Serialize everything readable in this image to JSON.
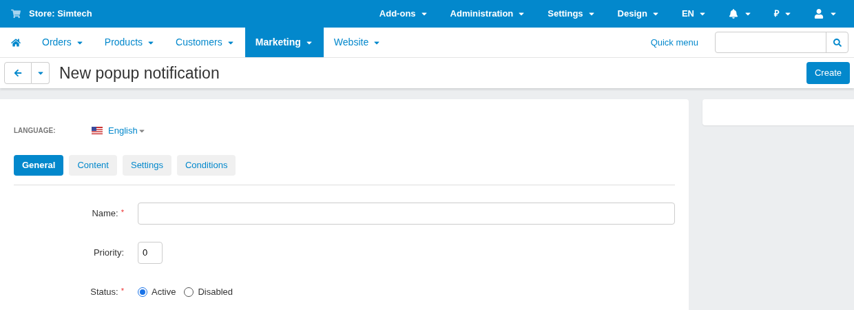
{
  "top_bar": {
    "store": "Store: Simtech",
    "menus": [
      {
        "kind": "text",
        "label": "Add-ons"
      },
      {
        "kind": "text",
        "label": "Administration"
      },
      {
        "kind": "text",
        "label": "Settings"
      },
      {
        "kind": "text",
        "label": "Design"
      },
      {
        "kind": "text",
        "label": "EN"
      },
      {
        "kind": "bell"
      },
      {
        "kind": "text",
        "label": "₽"
      },
      {
        "kind": "user"
      }
    ]
  },
  "nav": {
    "items": [
      {
        "label": "Orders",
        "selected": false
      },
      {
        "label": "Products",
        "selected": false
      },
      {
        "label": "Customers",
        "selected": false
      },
      {
        "label": "Marketing",
        "selected": true
      },
      {
        "label": "Website",
        "selected": false
      }
    ],
    "quick_menu": "Quick menu"
  },
  "header": {
    "title": "New popup notification",
    "create_button": "Create"
  },
  "language": {
    "label": "LANGUAGE:",
    "value": "English"
  },
  "tabs": [
    {
      "label": "General",
      "selected": true
    },
    {
      "label": "Content",
      "selected": false
    },
    {
      "label": "Settings",
      "selected": false
    },
    {
      "label": "Conditions",
      "selected": false
    }
  ],
  "fields": [
    {
      "kind": "text",
      "label": "Name:",
      "required_mark": "*"
    },
    {
      "kind": "number",
      "label": "Priority:",
      "value": "0"
    },
    {
      "kind": "radio",
      "label": "Status:",
      "required_mark": "*",
      "options": [
        {
          "label": "Active",
          "selected": true
        },
        {
          "label": "Disabled",
          "selected": false
        }
      ]
    }
  ]
}
